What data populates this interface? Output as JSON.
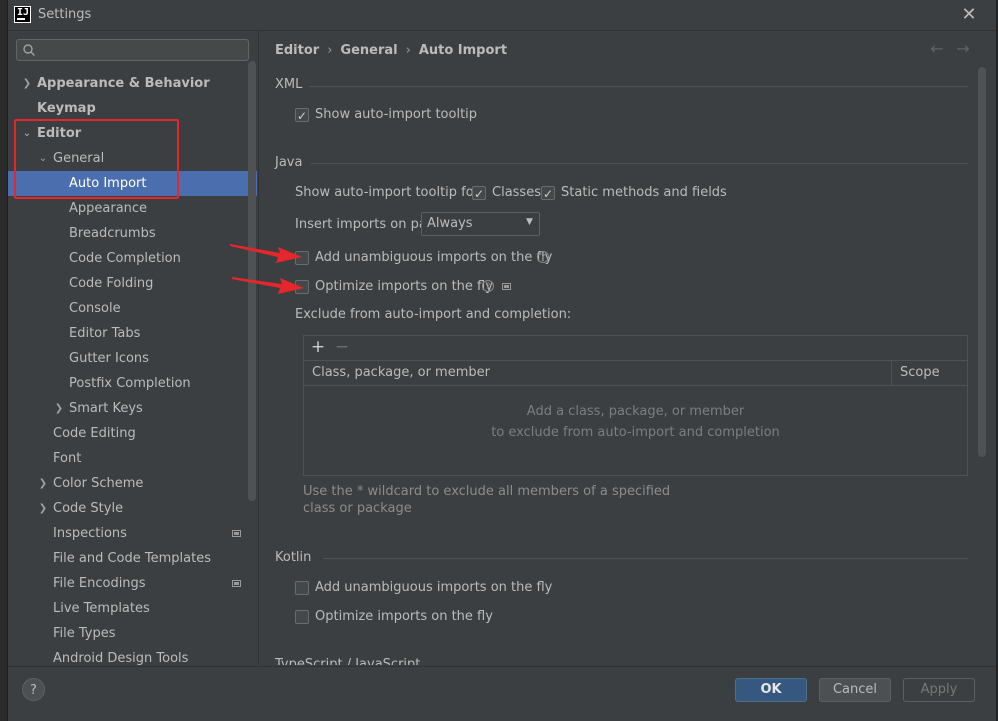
{
  "window": {
    "title": "Settings",
    "app_icon_text": "IJ"
  },
  "search": {
    "placeholder": "Q-"
  },
  "sidebar": {
    "items": [
      {
        "label": "Appearance & Behavior"
      },
      {
        "label": "Keymap"
      },
      {
        "label": "Editor"
      },
      {
        "label": "General"
      },
      {
        "label": "Auto Import"
      },
      {
        "label": "Appearance"
      },
      {
        "label": "Breadcrumbs"
      },
      {
        "label": "Code Completion"
      },
      {
        "label": "Code Folding"
      },
      {
        "label": "Console"
      },
      {
        "label": "Editor Tabs"
      },
      {
        "label": "Gutter Icons"
      },
      {
        "label": "Postfix Completion"
      },
      {
        "label": "Smart Keys"
      },
      {
        "label": "Code Editing"
      },
      {
        "label": "Font"
      },
      {
        "label": "Color Scheme"
      },
      {
        "label": "Code Style"
      },
      {
        "label": "Inspections"
      },
      {
        "label": "File and Code Templates"
      },
      {
        "label": "File Encodings"
      },
      {
        "label": "Live Templates"
      },
      {
        "label": "File Types"
      },
      {
        "label": "Android Design Tools"
      }
    ]
  },
  "breadcrumb": {
    "parts": [
      "Editor",
      "General",
      "Auto Import"
    ],
    "separator": "›"
  },
  "nav": {
    "back": "←",
    "forward": "→"
  },
  "xml": {
    "title": "XML",
    "show_tooltip": {
      "label": "Show auto-import tooltip",
      "checked": true
    }
  },
  "java": {
    "title": "Java",
    "tooltip_for_label": "Show auto-import tooltip for:",
    "classes": {
      "label": "Classes",
      "checked": true
    },
    "static_methods": {
      "label": "Static methods and fields",
      "checked": true
    },
    "insert_label": "Insert imports on paste:",
    "insert_value": "Always",
    "add_unambiguous": {
      "label": "Add unambiguous imports on the fly",
      "checked": false
    },
    "optimize": {
      "label": "Optimize imports on the fly",
      "checked": false
    },
    "exclude_label": "Exclude from auto-import and completion:",
    "table": {
      "add": "+",
      "remove": "−",
      "col_class": "Class, package, or member",
      "col_scope": "Scope",
      "empty_line1": "Add a class, package, or member",
      "empty_line2": "to exclude from auto-import and completion"
    },
    "wildcard_note": "Use the * wildcard to exclude all members of a specified class or package"
  },
  "kotlin": {
    "title": "Kotlin",
    "add_unambiguous": {
      "label": "Add unambiguous imports on the fly",
      "checked": false
    },
    "optimize": {
      "label": "Optimize imports on the fly",
      "checked": false
    }
  },
  "next_section": {
    "title": "TypeScript / JavaScript"
  },
  "buttons": {
    "help": "?",
    "ok": "OK",
    "cancel": "Cancel",
    "apply": "Apply"
  },
  "colors": {
    "selection": "#4b6eaf",
    "annotation_red": "#e5262c",
    "ok_button": "#365880"
  }
}
